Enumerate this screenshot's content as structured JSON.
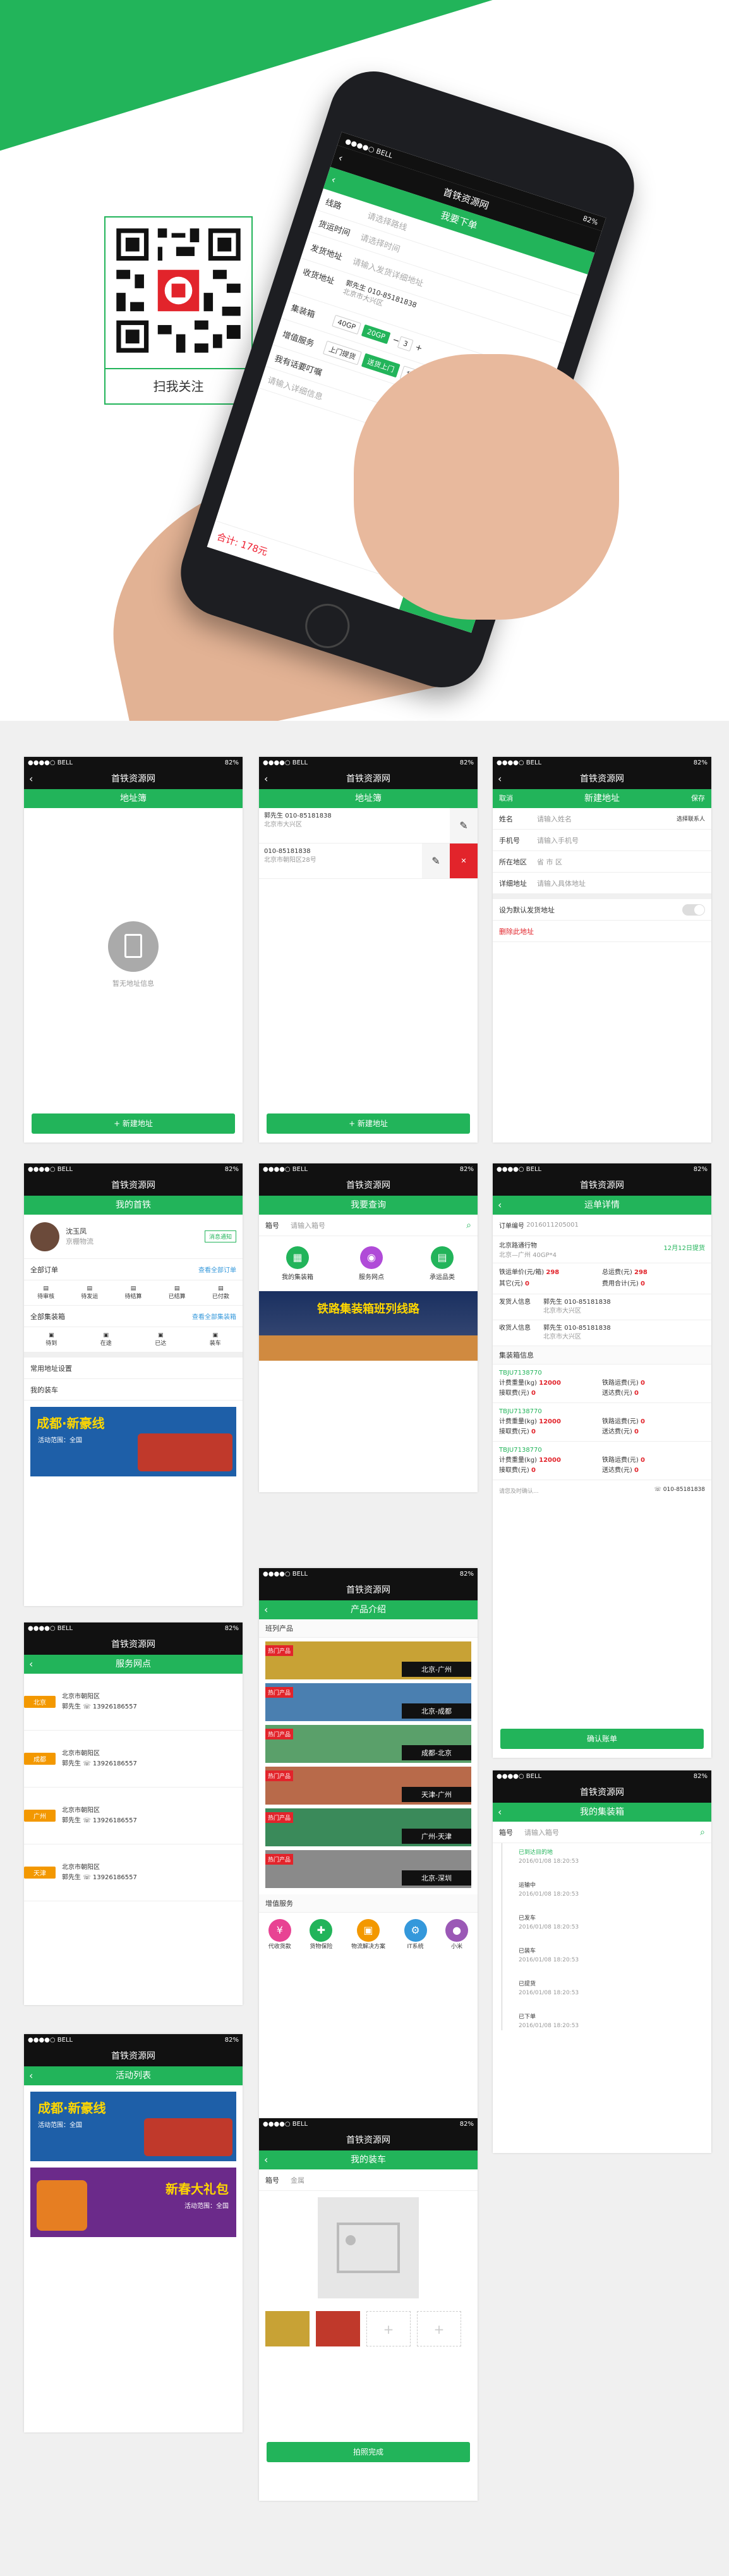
{
  "brand_color": "#22b45a",
  "qr": {
    "caption": "扫我关注"
  },
  "status": {
    "carrier": "●●●●○ BELL",
    "battery": "82%",
    "time": "9:41 AM"
  },
  "app_title": "首铁资源网",
  "hero_phone": {
    "header": "我要下单",
    "rows": [
      {
        "label": "线路",
        "value": "请选择路线"
      },
      {
        "label": "货运时间",
        "value": "请选择时间"
      }
    ],
    "ship_label": "发货地址",
    "ship_value": "请输入发货详细地址",
    "recv_label": "收货地址",
    "recv_name": "郭先生",
    "recv_phone": "010-85181838",
    "recv_addr": "北京市大兴区",
    "box_label": "集装箱",
    "box_opts": [
      "40GP",
      "20GP"
    ],
    "box_qty": "3",
    "service_label": "增值服务",
    "service_opts": [
      "上门提货",
      "送货上门",
      "货物保险"
    ],
    "other_label": "我有话要叮嘱",
    "other_placeholder": "请输入详细信息",
    "footer_price": "合计: 178元",
    "footer_btn": "提交"
  },
  "s1": {
    "title": "地址簿",
    "empty": "暂无地址信息",
    "btn": "+ 新建地址"
  },
  "s2": {
    "title": "地址簿",
    "items": [
      {
        "name": "郭先生",
        "phone": "010-85181838",
        "addr": "北京市大兴区"
      },
      {
        "name": "",
        "phone": "010-85181838",
        "addr": "北京市朝阳区28号"
      }
    ],
    "btn": "+ 新建地址"
  },
  "s3": {
    "title": "新建地址",
    "cancel": "取消",
    "save": "保存",
    "fields": [
      {
        "label": "姓名",
        "ph": "请输入姓名"
      },
      {
        "label": "手机号",
        "ph": "请输入手机号"
      },
      {
        "label": "所在地区",
        "ph": "省    市    区"
      },
      {
        "label": "详细地址",
        "ph": "请输入具体地址"
      }
    ],
    "contact": "选择联系人",
    "default_label": "设为默认发货地址",
    "delete": "删除此地址"
  },
  "s4": {
    "title": "我的首铁",
    "user": "沈玉凤",
    "company": "京棚物流",
    "badge": "消息通知",
    "orders_title": "全部订单",
    "orders_link": "查看全部订单",
    "orders": [
      "待审核",
      "待发运",
      "待结算",
      "已结算",
      "已付款"
    ],
    "box_title": "全部集装箱",
    "box_link": "查看全部集装箱",
    "boxes": [
      "待到",
      "在途",
      "已达",
      "装车"
    ],
    "menu": [
      "常用地址设置",
      "我的装车"
    ],
    "banner": "成都·新豪线",
    "banner_sub": "活动范围：全国"
  },
  "s5": {
    "title": "我要查询",
    "search_label": "箱号",
    "search_ph": "请输入箱号",
    "icons": [
      {
        "label": "我的集装箱",
        "color": "#22b45a"
      },
      {
        "label": "服务网点",
        "color": "#b04bd8"
      },
      {
        "label": "承运品类",
        "color": "#22b45a"
      }
    ],
    "banner": "铁路集装箱班列线路"
  },
  "s6": {
    "title": "运单详情",
    "order_no_label": "订单编号",
    "order_no": "2016011205001",
    "route": "北京路通行物",
    "route_sub": "北京—广州  40GP*4",
    "date": "12月12日提货",
    "price_label": "铁运单价(元/箱)",
    "price": "298",
    "total_label": "总运费(元)",
    "total": "298",
    "other_label": "其它(元)",
    "other": "0",
    "sum_label": "费用合计(元)",
    "sum": "0",
    "sender_label": "发货人信息",
    "sender_name": "郭先生",
    "sender_phone": "010-85181838",
    "sender_addr": "北京市大兴区",
    "receiver_label": "收货人信息",
    "receiver_name": "郭先生",
    "receiver_phone": "010-85181838",
    "receiver_addr": "北京市大兴区",
    "box_info": "集装箱信息",
    "boxes": [
      {
        "no": "TBJU7138770",
        "w_label": "计费重量(kg)",
        "w": "12000",
        "fee_label": "铁路运费(元)",
        "fee": "0",
        "pick_label": "接取费(元)",
        "pick": "0",
        "send_label": "送达费(元)",
        "send": "0"
      },
      {
        "no": "TBJU7138770",
        "w_label": "计费重量(kg)",
        "w": "12000",
        "fee_label": "铁路运费(元)",
        "fee": "0",
        "pick_label": "接取费(元)",
        "pick": "0",
        "send_label": "送达费(元)",
        "send": "0"
      },
      {
        "no": "TBJU7138770",
        "w_label": "计费重量(kg)",
        "w": "12000",
        "fee_label": "铁路运费(元)",
        "fee": "0",
        "pick_label": "接取费(元)",
        "pick": "0",
        "send_label": "送达费(元)",
        "send": "0"
      }
    ],
    "note": "请您及时确认...",
    "contact_phone": "010-85181838",
    "btn": "确认账单"
  },
  "s7": {
    "title": "服务网点",
    "items": [
      {
        "city": "北京",
        "color": "#f39800",
        "addr": "北京市朝阳区",
        "person": "郭先生",
        "phone": "13926186557"
      },
      {
        "city": "成都",
        "color": "#f39800",
        "addr": "北京市朝阳区",
        "person": "郭先生",
        "phone": "13926186557"
      },
      {
        "city": "广州",
        "color": "#f39800",
        "addr": "北京市朝阳区",
        "person": "郭先生",
        "phone": "13926186557"
      },
      {
        "city": "天津",
        "color": "#f39800",
        "addr": "北京市朝阳区",
        "person": "郭先生",
        "phone": "13926186557"
      }
    ]
  },
  "s8": {
    "title": "产品介绍",
    "section1": "班列产品",
    "products": [
      {
        "route": "北京-广州",
        "color": "#c8a235"
      },
      {
        "route": "北京-成都",
        "color": "#4a7fb0"
      },
      {
        "route": "成都-北京",
        "color": "#5aa06a"
      },
      {
        "route": "天津-广州",
        "color": "#b86a4a"
      },
      {
        "route": "广州-天津",
        "color": "#3a8a5a"
      },
      {
        "route": "北京-深圳",
        "color": "#8a8a8a"
      }
    ],
    "hot": "热门产品",
    "section2": "增值服务",
    "services": [
      {
        "label": "代收货款",
        "color": "#e84393"
      },
      {
        "label": "货物保险",
        "color": "#22b45a"
      },
      {
        "label": "物流解决方案",
        "color": "#f39800"
      },
      {
        "label": "IT系统",
        "color": "#3498db"
      },
      {
        "label": "小米",
        "color": "#9b59b6"
      }
    ]
  },
  "s9": {
    "title": "活动列表",
    "banners": [
      {
        "text": "成都·新豪线",
        "sub": "活动范围：全国",
        "color": "#1e5fa8"
      },
      {
        "text": "新春大礼包",
        "sub": "活动范围：全国",
        "color": "#6b2a8a"
      }
    ]
  },
  "s10": {
    "title": "我的集装箱",
    "search_label": "箱号",
    "search_ph": "请输入箱号",
    "timeline": [
      {
        "text": "已到达目的地",
        "time": "2016/01/08 18:20:53"
      },
      {
        "text": "运输中",
        "time": "2016/01/08 18:20:53"
      },
      {
        "text": "已发车",
        "time": "2016/01/08 18:20:53"
      },
      {
        "text": "已装车",
        "time": "2016/01/08 18:20:53"
      },
      {
        "text": "已提货",
        "time": "2016/01/08 18:20:53"
      },
      {
        "text": "已下单",
        "time": "2016/01/08 18:20:53"
      }
    ]
  },
  "s11": {
    "title": "我的装车",
    "search_label": "箱号",
    "search_ph": "金属",
    "btn": "拍照完成"
  }
}
